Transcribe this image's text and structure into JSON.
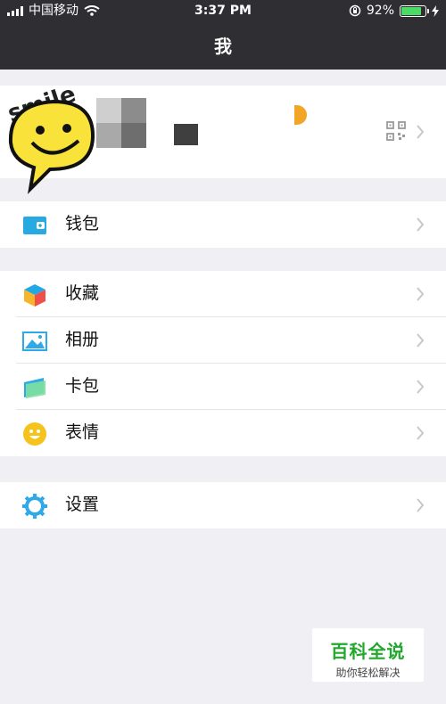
{
  "status": {
    "carrier": "中国移动",
    "time": "3:37 PM",
    "battery_percent": "92%",
    "battery_level": 0.92,
    "colors": {
      "battery_fill": "#4cd964"
    }
  },
  "header": {
    "title": "我"
  },
  "profile": {
    "has_qr_icon": true
  },
  "groups": [
    {
      "items": [
        {
          "label": "钱包",
          "icon": "wallet-icon",
          "color": "#27a9e1"
        }
      ]
    },
    {
      "items": [
        {
          "label": "收藏",
          "icon": "favorites-cube-icon",
          "color": "#f7b52c"
        },
        {
          "label": "相册",
          "icon": "album-icon",
          "color": "#2fa9e8"
        },
        {
          "label": "卡包",
          "icon": "card-wallet-icon",
          "color": "#2fa9e8"
        },
        {
          "label": "表情",
          "icon": "emoji-icon",
          "color": "#f6c31c"
        }
      ]
    },
    {
      "items": [
        {
          "label": "设置",
          "icon": "settings-gear-icon",
          "color": "#2fa9e8"
        }
      ]
    }
  ],
  "watermark": {
    "title": "百科全说",
    "subtitle": "助你轻松解决"
  },
  "sticker": {
    "text": "smile"
  }
}
